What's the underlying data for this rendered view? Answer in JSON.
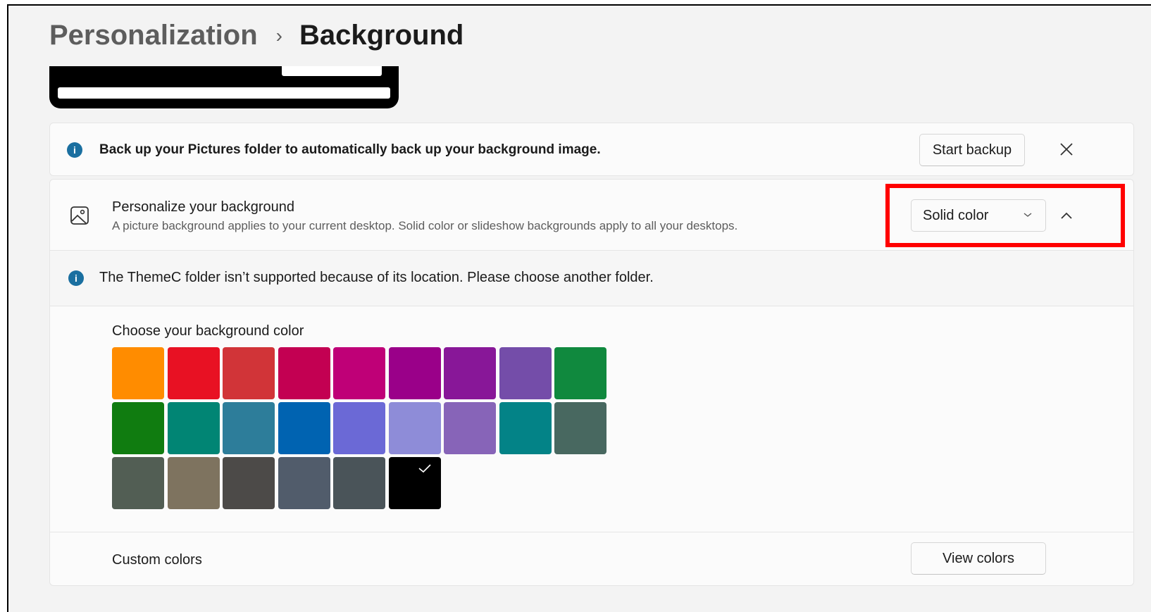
{
  "breadcrumb": {
    "parent": "Personalization",
    "separator": "›",
    "current": "Background"
  },
  "banner": {
    "message": "Back up your Pictures folder to automatically back up your background image.",
    "button_label": "Start backup"
  },
  "personalize": {
    "title": "Personalize your background",
    "subtitle": "A picture background applies to your current desktop. Solid color or slideshow backgrounds apply to all your desktops.",
    "dropdown_value": "Solid color"
  },
  "warning": {
    "message": "The ThemeC folder isn’t supported because of its location. Please choose another folder."
  },
  "colors": {
    "label": "Choose your background color",
    "swatches": [
      "#ff8c00",
      "#e81123",
      "#d13438",
      "#c30052",
      "#bf0077",
      "#9a0089",
      "#881798",
      "#744da9",
      "#10893e",
      "#107c10",
      "#018574",
      "#2d7d9a",
      "#0063b1",
      "#6b69d6",
      "#8e8cd8",
      "#8764b8",
      "#038387",
      "#486860",
      "#525e54",
      "#7e735f",
      "#4c4a48",
      "#515c6b",
      "#4a5459",
      "#000000"
    ],
    "selected_index": 23
  },
  "custom": {
    "label": "Custom colors",
    "button_label": "View colors"
  },
  "accent": {
    "highlight": "#ff0000",
    "info": "#1a6fa0"
  }
}
